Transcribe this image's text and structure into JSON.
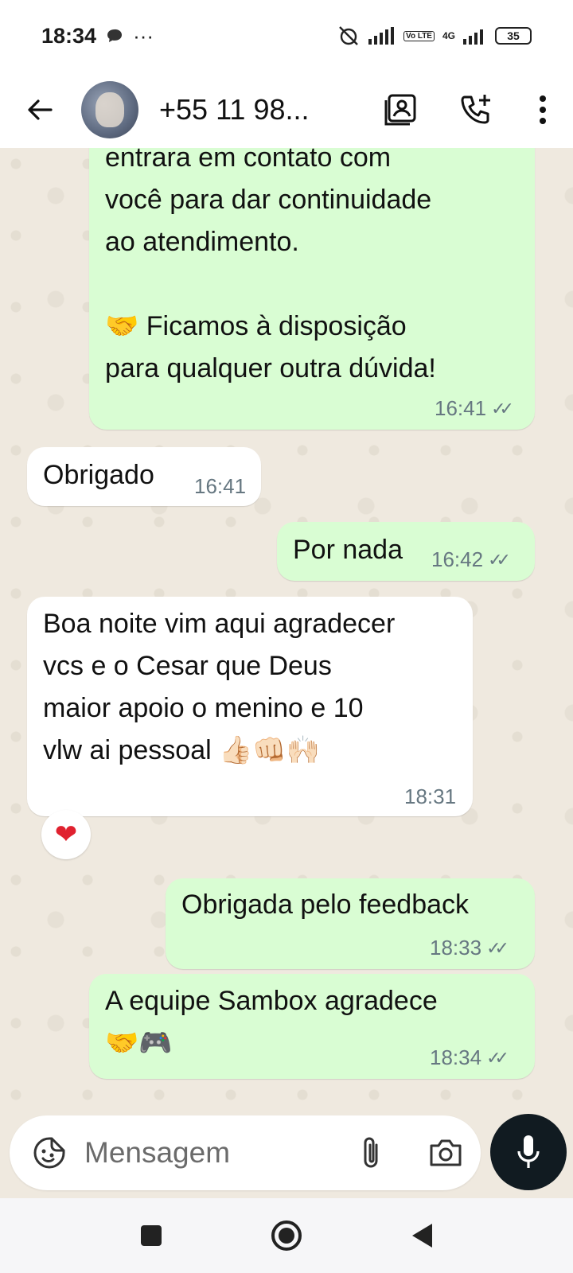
{
  "status_bar": {
    "time": "18:34",
    "more": "···",
    "network_type": "4G",
    "volte": "Vo LTE",
    "battery": "35"
  },
  "header": {
    "contact_name": "+55 11 98...",
    "icons": [
      "back-arrow-icon",
      "contacts-icon",
      "add-call-icon",
      "more-vert-icon"
    ]
  },
  "messages": {
    "m1": {
      "line1": "entrara em contato com",
      "line2": "você para dar continuidade",
      "line3": "ao atendimento.",
      "line4": "🤝 Ficamos à disposição",
      "line5": "para qualquer outra dúvida!",
      "time": "16:41"
    },
    "m2": {
      "text": "Obrigado",
      "time": "16:41"
    },
    "m3": {
      "text": "Por nada",
      "time": "16:42"
    },
    "m4": {
      "line1": "Boa noite vim aqui agradecer",
      "line2": "vcs e o Cesar que Deus",
      "line3": "maior apoio o menino e 10",
      "line4": "vlw ai pessoal 👍🏻👊🏻🙌🏻",
      "time": "18:31",
      "reaction": "❤"
    },
    "m5": {
      "text": "Obrigada pelo feedback",
      "time": "18:33"
    },
    "m6": {
      "line1": "A equipe Sambox agradece",
      "line2": "🤝🎮",
      "time": "18:34"
    }
  },
  "composer": {
    "placeholder": "Mensagem"
  },
  "colors": {
    "outgoing_bubble": "#d9fdd3",
    "incoming_bubble": "#ffffff",
    "chat_background": "#efe9df",
    "mic_button": "#111b21"
  }
}
